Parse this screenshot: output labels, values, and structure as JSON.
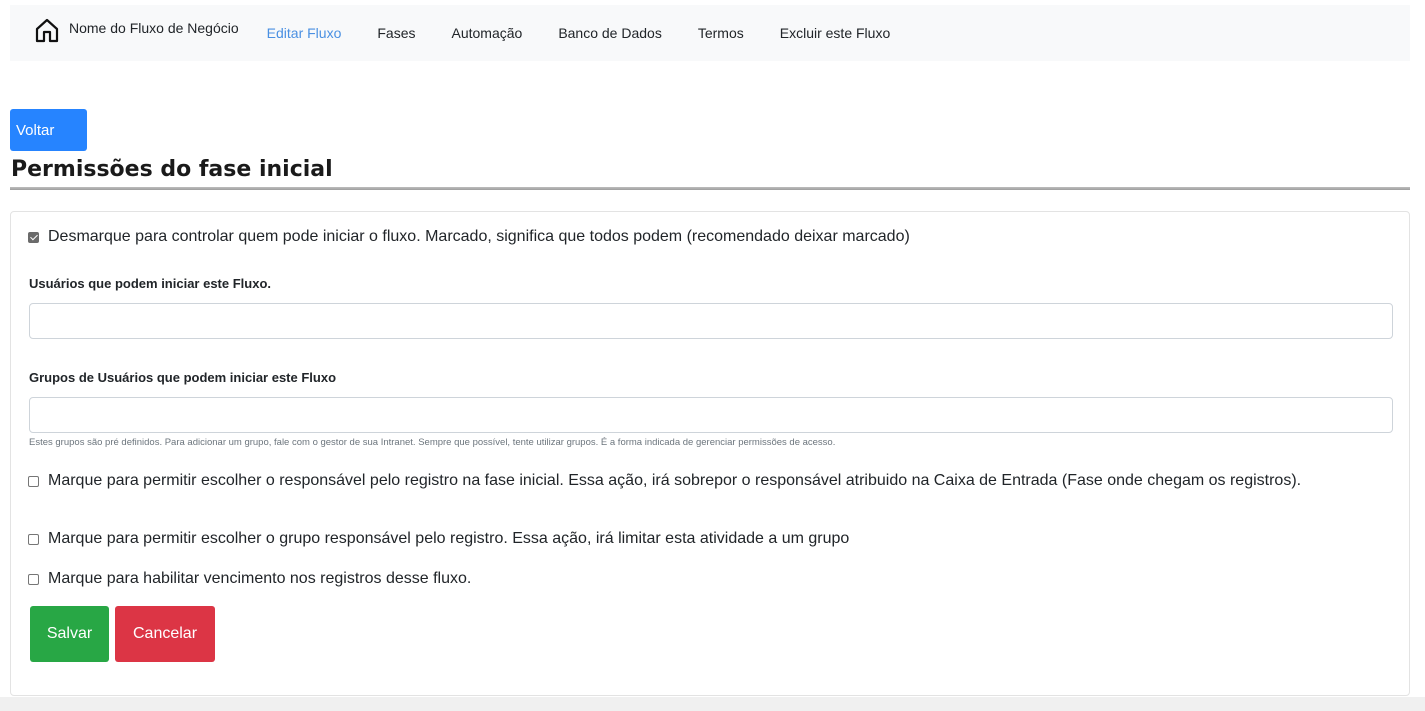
{
  "nav": {
    "brand": "Nome do Fluxo de Negócio",
    "links": [
      "Editar Fluxo",
      "Fases",
      "Automação",
      "Banco de Dados",
      "Termos",
      "Excluir este Fluxo"
    ],
    "active_index": 0
  },
  "back_button": "Voltar",
  "page_title": "Permissões do fase inicial",
  "form": {
    "allow_all": {
      "label": "Desmarque para controlar quem pode iniciar o fluxo. Marcado, significa que todos podem (recomendado deixar marcado)",
      "checked": true
    },
    "users_label": "Usuários que podem iniciar este Fluxo.",
    "users_value": "",
    "groups_label": "Grupos de Usuários que podem iniciar este Fluxo",
    "groups_value": "",
    "groups_help": "Estes grupos são pré definidos. Para adicionar um grupo, fale com o gestor de sua Intranet. Sempre que possível, tente utilizar grupos. É a forma indicada de gerenciar permissões de acesso.",
    "choose_responsible": {
      "label": "Marque para permitir escolher o responsável pelo registro na fase inicial. Essa ação, irá sobrepor o responsável atribuido na Caixa de Entrada (Fase onde chegam os registros).",
      "checked": false
    },
    "choose_group": {
      "label": "Marque para permitir escolher o grupo responsável pelo registro. Essa ação, irá limitar esta atividade a um grupo",
      "checked": false
    },
    "enable_due": {
      "label": "Marque para habilitar vencimento nos registros desse fluxo.",
      "checked": false
    },
    "save_label": "Salvar",
    "cancel_label": "Cancelar"
  },
  "colors": {
    "primary": "#2684ff",
    "active_link": "#4a90e2",
    "success": "#28a745",
    "danger": "#dc3545"
  }
}
